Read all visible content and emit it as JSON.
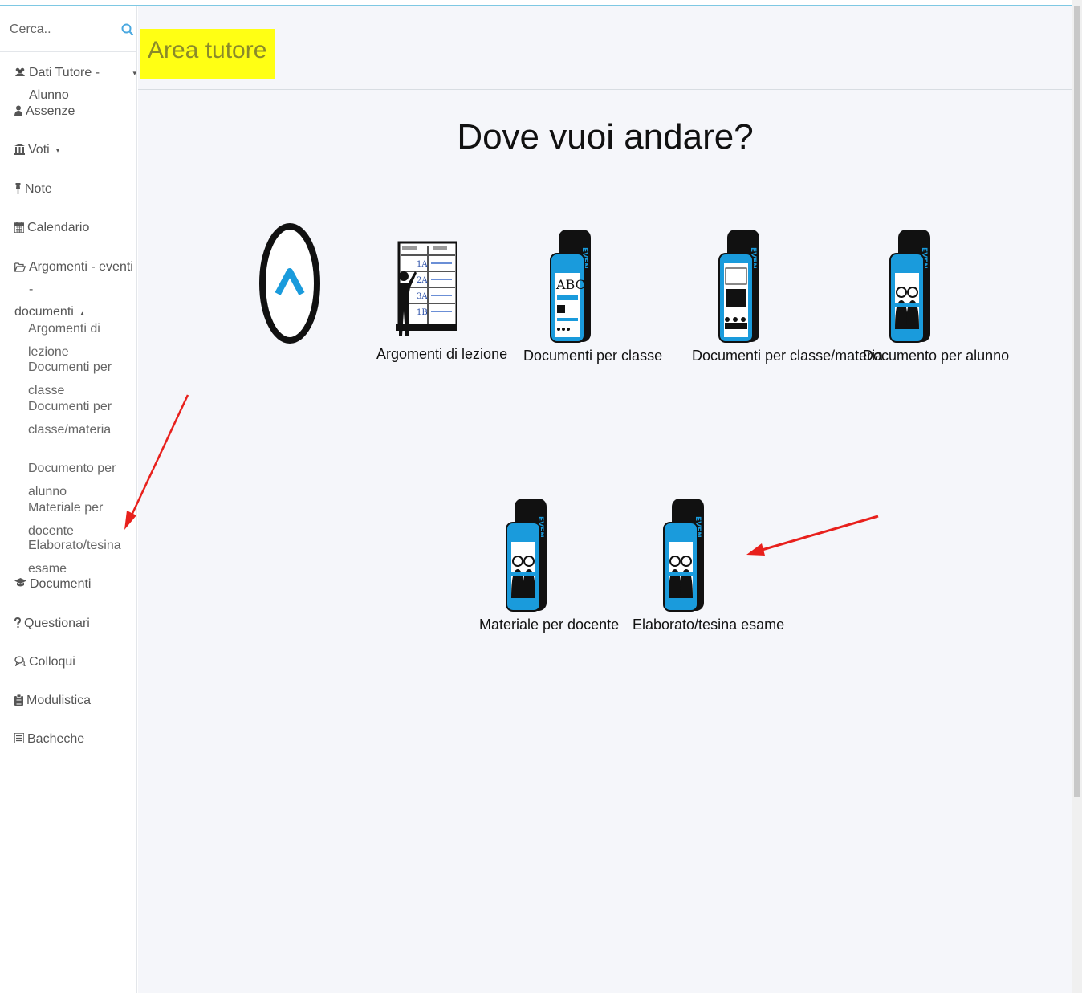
{
  "search": {
    "placeholder": "Cerca.."
  },
  "sidebar": {
    "items": [
      {
        "label": "Dati Tutore - Alunno",
        "icon": "users-icon",
        "caret": "▾"
      },
      {
        "label": "Assenze",
        "icon": "user-icon"
      },
      {
        "label": "Voti",
        "icon": "bank-icon",
        "caret": "▾"
      },
      {
        "label": "Note",
        "icon": "pin-icon"
      },
      {
        "label": "Calendario",
        "icon": "calendar-icon"
      },
      {
        "label": "Argomenti - eventi -",
        "label2": "documenti",
        "icon": "folder-open-icon",
        "caret": "▴"
      }
    ],
    "subitems": [
      "Argomenti di lezione",
      "Documenti per classe",
      "Documenti per",
      "classe/materia",
      "Documento per alunno",
      "Materiale per docente",
      "Elaborato/tesina esame"
    ],
    "items_bottom": [
      {
        "label": "Documenti",
        "icon": "graduation-cap-icon"
      },
      {
        "label": "Questionari",
        "icon": "question-icon"
      },
      {
        "label": "Colloqui",
        "icon": "chat-icon"
      },
      {
        "label": "Modulistica",
        "icon": "clipboard-icon"
      },
      {
        "label": "Bacheche",
        "icon": "list-icon"
      }
    ]
  },
  "header": {
    "title": "Area tutore"
  },
  "main": {
    "question": "Dove vuoi andare?",
    "tiles": [
      {
        "label": "Argomenti di lezione",
        "icon": "blackboard-teacher-icon"
      },
      {
        "label": "Documenti per classe",
        "icon": "tablet-abc-icon"
      },
      {
        "label": "Documenti per classe/materia",
        "icon": "tablet-class-icon"
      },
      {
        "label": "Documento per alunno",
        "icon": "tablet-student-icon"
      },
      {
        "label": "Materiale per docente",
        "icon": "tablet-teachers-icon"
      },
      {
        "label": "Elaborato/tesina esame",
        "icon": "tablet-exam-icon"
      }
    ],
    "back_button_icon": "chevron-up-icon"
  },
  "tablet_brand_text": "EVEN",
  "colors": {
    "accent": "#1a9bdc",
    "highlight": "#ffff14",
    "arrow": "#e8201c"
  }
}
